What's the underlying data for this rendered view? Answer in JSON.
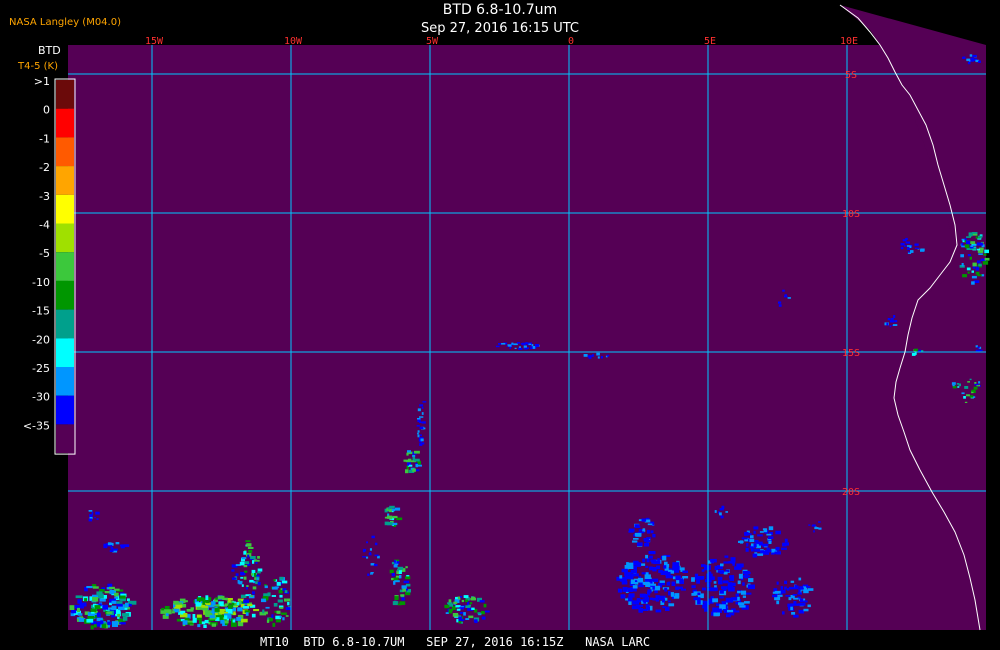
{
  "header": {
    "title": "BTD 6.8-10.7um",
    "subtitle": "Sep 27, 2016 16:15 UTC",
    "producer": "NASA Langley (M04.0)"
  },
  "legend": {
    "title_line1": "BTD",
    "title_line2": "T4-5 (K)",
    "entries": [
      {
        "label": ">1",
        "color": "#6b0a0a"
      },
      {
        "label": "0",
        "color": "#ff0000"
      },
      {
        "label": "-1",
        "color": "#ff5a00"
      },
      {
        "label": "-2",
        "color": "#ffa500"
      },
      {
        "label": "-3",
        "color": "#ffff00"
      },
      {
        "label": "-4",
        "color": "#a0e000"
      },
      {
        "label": "-5",
        "color": "#3cc83c"
      },
      {
        "label": "-10",
        "color": "#009600"
      },
      {
        "label": "-15",
        "color": "#00a08c"
      },
      {
        "label": "-20",
        "color": "#00ffff"
      },
      {
        "label": "-25",
        "color": "#0096ff"
      },
      {
        "label": "-30",
        "color": "#0000ff"
      },
      {
        "label": "<-35",
        "color": "#550055"
      }
    ]
  },
  "map": {
    "background_color": "#550055",
    "grid_color": "#00c8ff",
    "coast_color": "#ffffff",
    "lon_labels": [
      "15W",
      "10W",
      "5W",
      "0",
      "5E",
      "10E"
    ],
    "lat_labels": [
      "5S",
      "10S",
      "15S",
      "20S"
    ]
  },
  "footer": {
    "text": "MT10  BTD 6.8-10.7UM   SEP 27, 2016 16:15Z   NASA LARC"
  }
}
